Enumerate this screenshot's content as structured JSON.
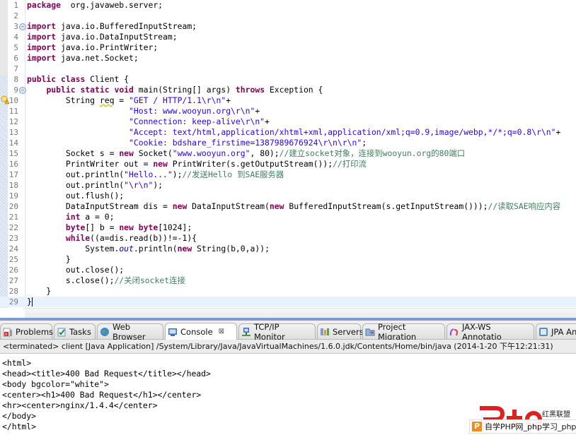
{
  "editor": {
    "lines": [
      {
        "n": "1",
        "fold": false,
        "warn": false,
        "segs": [
          [
            "kw",
            "package"
          ],
          [
            "",
            "  org.javaweb.server;"
          ]
        ]
      },
      {
        "n": "2",
        "segs": []
      },
      {
        "n": "3",
        "fold": true,
        "segs": [
          [
            "kw",
            "import"
          ],
          [
            "",
            " java.io.BufferedInputStream;"
          ]
        ]
      },
      {
        "n": "4",
        "segs": [
          [
            "kw",
            "import"
          ],
          [
            "",
            " java.io.DataInputStream;"
          ]
        ]
      },
      {
        "n": "5",
        "segs": [
          [
            "kw",
            "import"
          ],
          [
            "",
            " java.io.PrintWriter;"
          ]
        ]
      },
      {
        "n": "6",
        "segs": [
          [
            "kw",
            "import"
          ],
          [
            "",
            " java.net.Socket;"
          ]
        ]
      },
      {
        "n": "7",
        "segs": []
      },
      {
        "n": "8",
        "segs": [
          [
            "kw",
            "public"
          ],
          [
            "",
            " "
          ],
          [
            "kw",
            "class"
          ],
          [
            "",
            " Client {"
          ]
        ]
      },
      {
        "n": "9",
        "fold": true,
        "segs": [
          [
            "",
            "    "
          ],
          [
            "kw",
            "public"
          ],
          [
            "",
            " "
          ],
          [
            "kw",
            "static"
          ],
          [
            "",
            " "
          ],
          [
            "kw",
            "void"
          ],
          [
            "",
            " main(String[] args) "
          ],
          [
            "kw",
            "throws"
          ],
          [
            "",
            " Exception {"
          ]
        ]
      },
      {
        "n": "10",
        "warn": true,
        "segs": [
          [
            "",
            "        String "
          ],
          [
            "und",
            "req"
          ],
          [
            "",
            " = "
          ],
          [
            "str",
            "\"GET / HTTP/1.1\\r\\n\""
          ],
          [
            "",
            "+"
          ]
        ]
      },
      {
        "n": "11",
        "segs": [
          [
            "",
            "                     "
          ],
          [
            "str",
            "\"Host: www.wooyun.org\\r\\n\""
          ],
          [
            "",
            "+"
          ]
        ]
      },
      {
        "n": "12",
        "segs": [
          [
            "",
            "                     "
          ],
          [
            "str",
            "\"Connection: keep-alive\\r\\n\""
          ],
          [
            "",
            "+"
          ]
        ]
      },
      {
        "n": "13",
        "segs": [
          [
            "",
            "                     "
          ],
          [
            "str",
            "\"Accept: text/html,application/xhtml+xml,application/xml;q=0.9,image/webp,*/*;q=0.8\\r\\n\""
          ],
          [
            "",
            "+"
          ]
        ]
      },
      {
        "n": "14",
        "segs": [
          [
            "",
            "                     "
          ],
          [
            "str",
            "\"Cookie: bdshare_firstime=1387989676924\\r\\n\\r\\n\""
          ],
          [
            "",
            ";"
          ]
        ]
      },
      {
        "n": "15",
        "segs": [
          [
            "",
            "        Socket s = "
          ],
          [
            "kw",
            "new"
          ],
          [
            "",
            " Socket("
          ],
          [
            "str",
            "\"www.wooyun.org\""
          ],
          [
            "",
            ", 80);"
          ],
          [
            "cm",
            "//建立socket对象，连接到wooyun.org的80端口"
          ]
        ]
      },
      {
        "n": "16",
        "segs": [
          [
            "",
            "        PrintWriter out = "
          ],
          [
            "kw",
            "new"
          ],
          [
            "",
            " PrintWriter(s.getOutputStream());"
          ],
          [
            "cm",
            "//打印流"
          ]
        ]
      },
      {
        "n": "17",
        "segs": [
          [
            "",
            "        out.println("
          ],
          [
            "str",
            "\"Hello...\""
          ],
          [
            "",
            ");"
          ],
          [
            "cm",
            "//发送Hello 到SAE服务器"
          ]
        ]
      },
      {
        "n": "18",
        "segs": [
          [
            "",
            "        out.println("
          ],
          [
            "str",
            "\"\\r\\n\""
          ],
          [
            "",
            ");"
          ]
        ]
      },
      {
        "n": "19",
        "segs": [
          [
            "",
            "        out.flush();"
          ]
        ]
      },
      {
        "n": "20",
        "segs": [
          [
            "",
            "        DataInputStream dis = "
          ],
          [
            "kw",
            "new"
          ],
          [
            "",
            " DataInputStream("
          ],
          [
            "kw",
            "new"
          ],
          [
            "",
            " BufferedInputStream(s.getInputStream()));"
          ],
          [
            "cm",
            "//读取SAE响应内容"
          ]
        ]
      },
      {
        "n": "21",
        "segs": [
          [
            "",
            "        "
          ],
          [
            "kw",
            "int"
          ],
          [
            "",
            " a = 0;"
          ]
        ]
      },
      {
        "n": "22",
        "segs": [
          [
            "",
            "        "
          ],
          [
            "kw",
            "byte"
          ],
          [
            "",
            "[] b = "
          ],
          [
            "kw",
            "new"
          ],
          [
            "",
            " "
          ],
          [
            "kw",
            "byte"
          ],
          [
            "",
            "[1024];"
          ]
        ]
      },
      {
        "n": "23",
        "segs": [
          [
            "",
            "        "
          ],
          [
            "kw",
            "while"
          ],
          [
            "",
            "((a=dis.read(b))!=-1){"
          ]
        ]
      },
      {
        "n": "24",
        "segs": [
          [
            "",
            "            System."
          ],
          [
            "fld",
            "out"
          ],
          [
            "",
            ".println("
          ],
          [
            "kw",
            "new"
          ],
          [
            "",
            " String(b,0,a));"
          ]
        ]
      },
      {
        "n": "25",
        "segs": [
          [
            "",
            "        }"
          ]
        ]
      },
      {
        "n": "26",
        "segs": [
          [
            "",
            "        out.close();"
          ]
        ]
      },
      {
        "n": "27",
        "segs": [
          [
            "",
            "        s.close();"
          ],
          [
            "cm",
            "//关闭socket连接"
          ]
        ]
      },
      {
        "n": "28",
        "segs": [
          [
            "",
            "    }"
          ]
        ]
      },
      {
        "n": "29",
        "current": true,
        "segs": [
          [
            "",
            "}"
          ]
        ]
      }
    ]
  },
  "tabs": [
    {
      "label": "Problems",
      "icon": "problems-icon"
    },
    {
      "label": "Tasks",
      "icon": "tasks-icon"
    },
    {
      "label": "Web Browser",
      "icon": "globe-icon"
    },
    {
      "label": "Console",
      "icon": "console-icon",
      "active": true,
      "close": "⊠"
    },
    {
      "label": "TCP/IP Monitor",
      "icon": "network-monitor-icon"
    },
    {
      "label": "Servers",
      "icon": "servers-icon"
    },
    {
      "label": "Project Migration",
      "icon": "folder-migration-icon"
    },
    {
      "label": "JAX-WS Annotatio",
      "icon": "jaxws-icon"
    },
    {
      "label": "JPA An",
      "icon": "jpa-icon"
    }
  ],
  "console": {
    "status": "<terminated> client [Java Application] /System/Library/Java/JavaVirtualMachines/1.6.0.jdk/Contents/Home/bin/java (2014-1-20 下午12:21:31)",
    "output": [
      "<html>",
      "<head><title>400 Bad Request</title></head>",
      "<body bgcolor=\"white\">",
      "<center><h1>400 Bad Request</h1></center>",
      "<hr><center>nginx/1.4.4</center>",
      "</body>",
      "</html>"
    ]
  },
  "watermark": {
    "brand": "红黑联盟",
    "bar_text": "自学PHP网_php学习_php教",
    "bar_icon_letter": "P",
    "logo_color": "#e02020"
  }
}
